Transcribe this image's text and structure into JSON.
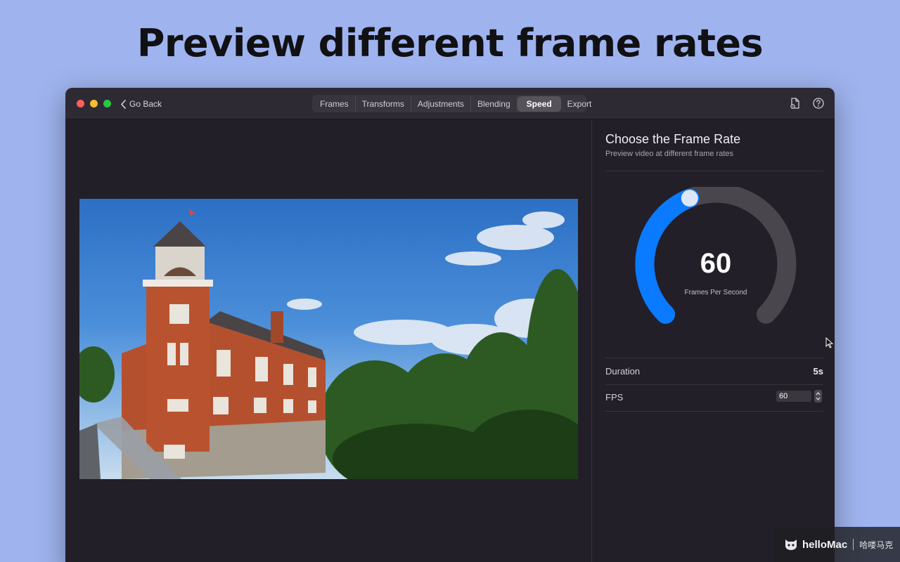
{
  "headline": "Preview different frame rates",
  "window": {
    "go_back_label": "Go Back",
    "tabs": [
      {
        "label": "Frames",
        "active": false
      },
      {
        "label": "Transforms",
        "active": false
      },
      {
        "label": "Adjustments",
        "active": false
      },
      {
        "label": "Blending",
        "active": false
      },
      {
        "label": "Speed",
        "active": true
      },
      {
        "label": "Export",
        "active": false
      }
    ],
    "toolbar_icons": [
      "document-settings-icon",
      "help-icon"
    ]
  },
  "panel": {
    "title": "Choose the Frame Rate",
    "subtitle": "Preview video at different frame rates",
    "gauge": {
      "value": "60",
      "label": "Frames Per Second",
      "fill_fraction": 0.42,
      "fill_color": "#0a7aff",
      "track_color": "#49464e"
    },
    "duration": {
      "label": "Duration",
      "value": "5s"
    },
    "fps": {
      "label": "FPS",
      "value": "60"
    }
  },
  "watermark": {
    "brand": "helloMac",
    "chinese": "哈喽马克"
  }
}
